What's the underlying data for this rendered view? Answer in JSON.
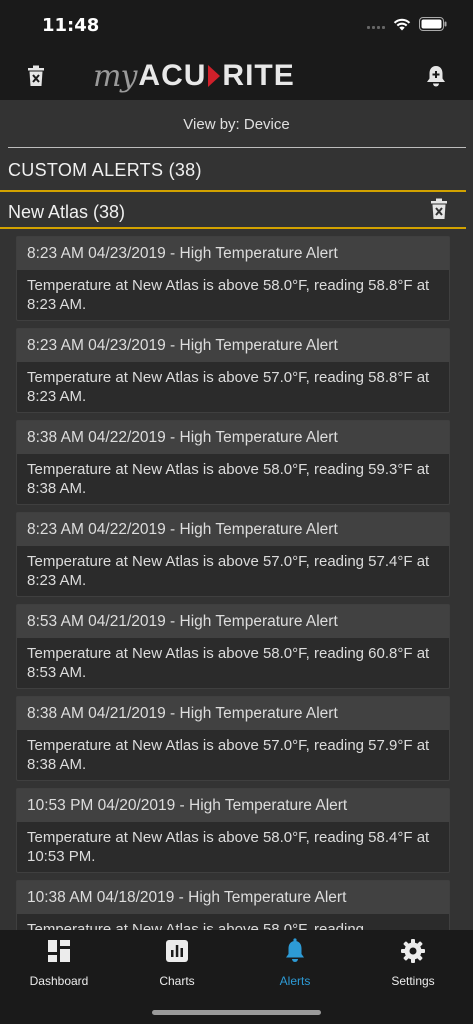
{
  "status_bar": {
    "time": "11:48"
  },
  "header": {
    "logo_my": "my",
    "logo_acu": "ACU",
    "logo_rite": "RITE",
    "left_icon": "trash-icon",
    "right_icon": "add-alert-bell-icon"
  },
  "view_by": {
    "label": "View by: Device"
  },
  "section": {
    "title": "CUSTOM ALERTS (38)"
  },
  "device": {
    "name": "New Atlas (38)"
  },
  "alerts": [
    {
      "title": "8:23 AM 04/23/2019 - High Temperature Alert",
      "message": "Temperature at New Atlas is above 58.0°F, reading 58.8°F at 8:23 AM."
    },
    {
      "title": "8:23 AM 04/23/2019 - High Temperature Alert",
      "message": "Temperature at New Atlas is above 57.0°F, reading 58.8°F at 8:23 AM."
    },
    {
      "title": "8:38 AM 04/22/2019 - High Temperature Alert",
      "message": "Temperature at New Atlas is above 58.0°F, reading 59.3°F at 8:38 AM."
    },
    {
      "title": "8:23 AM 04/22/2019 - High Temperature Alert",
      "message": "Temperature at New Atlas is above 57.0°F, reading 57.4°F at 8:23 AM."
    },
    {
      "title": "8:53 AM 04/21/2019 - High Temperature Alert",
      "message": "Temperature at New Atlas is above 58.0°F, reading 60.8°F at 8:53 AM."
    },
    {
      "title": "8:38 AM 04/21/2019 - High Temperature Alert",
      "message": "Temperature at New Atlas is above 57.0°F, reading 57.9°F at 8:38 AM."
    },
    {
      "title": "10:53 PM 04/20/2019 - High Temperature Alert",
      "message": "Temperature at New Atlas is above 58.0°F, reading 58.4°F at 10:53 PM."
    },
    {
      "title": "10:38 AM 04/18/2019 - High Temperature Alert",
      "message": "Temperature at New Atlas is above 58.0°F, reading"
    }
  ],
  "tabs": [
    {
      "label": "Dashboard",
      "icon": "dashboard-icon"
    },
    {
      "label": "Charts",
      "icon": "charts-icon"
    },
    {
      "label": "Alerts",
      "icon": "bell-icon",
      "active": true
    },
    {
      "label": "Settings",
      "icon": "gear-icon"
    }
  ],
  "colors": {
    "accent": "#2d9bd6",
    "divider_gold": "#d2a200",
    "logo_red": "#d0202a",
    "background": "#333333",
    "bar": "#1a1a1a"
  }
}
